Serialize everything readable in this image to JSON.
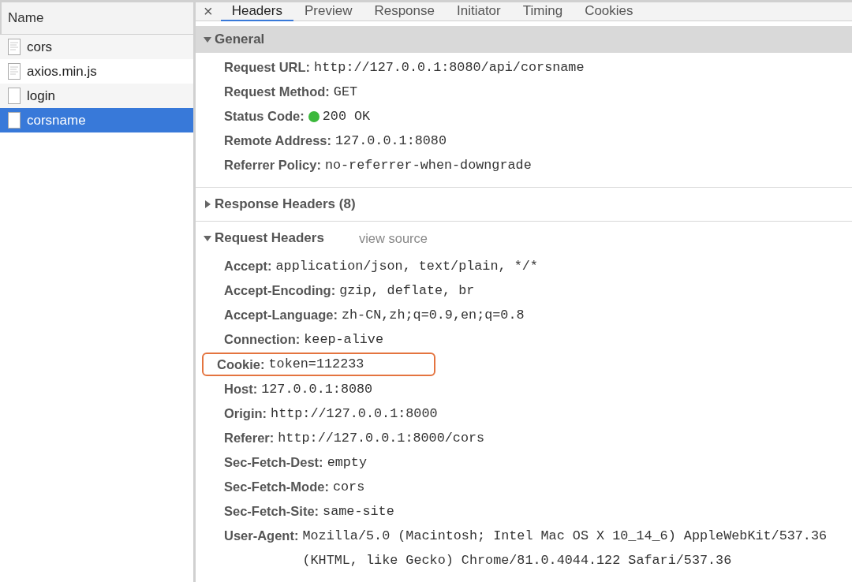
{
  "requests": {
    "column": "Name",
    "items": [
      {
        "name": "cors",
        "kind": "document",
        "selected": false
      },
      {
        "name": "axios.min.js",
        "kind": "document",
        "selected": false
      },
      {
        "name": "login",
        "kind": "blank",
        "selected": false
      },
      {
        "name": "corsname",
        "kind": "blank",
        "selected": true
      }
    ]
  },
  "close": "×",
  "tabs": [
    {
      "label": "Headers",
      "selected": true
    },
    {
      "label": "Preview",
      "selected": false
    },
    {
      "label": "Response",
      "selected": false
    },
    {
      "label": "Initiator",
      "selected": false
    },
    {
      "label": "Timing",
      "selected": false
    },
    {
      "label": "Cookies",
      "selected": false
    }
  ],
  "sections": [
    {
      "title": "General",
      "kind": "shaded",
      "expanded": true,
      "rows": [
        {
          "name": "Request URL:",
          "value": "http://127.0.0.1:8080/api/corsname",
          "highlighted": false
        },
        {
          "name": "Request Method:",
          "value": "GET",
          "highlighted": false
        },
        {
          "name": "Status Code:",
          "value": "200 OK",
          "color": "#3cb83c",
          "highlighted": false
        },
        {
          "name": "Remote Address:",
          "value": "127.0.0.1:8080",
          "highlighted": false
        },
        {
          "name": "Referrer Policy:",
          "value": "no-referrer-when-downgrade",
          "highlighted": false
        }
      ]
    },
    {
      "title": "Response Headers (8)",
      "kind": "plain",
      "expanded": false
    },
    {
      "title": "Request Headers",
      "kind": "plain",
      "expanded": true,
      "link": "view source",
      "rows": [
        {
          "name": "Accept:",
          "value": "application/json, text/plain, */*",
          "highlighted": false
        },
        {
          "name": "Accept-Encoding:",
          "value": "gzip, deflate, br",
          "highlighted": false
        },
        {
          "name": "Accept-Language:",
          "value": "zh-CN,zh;q=0.9,en;q=0.8",
          "highlighted": false
        },
        {
          "name": "Connection:",
          "value": "keep-alive",
          "highlighted": false
        },
        {
          "name": "Cookie:",
          "value": "token=112233",
          "highlighted": true
        },
        {
          "name": "Host:",
          "value": "127.0.0.1:8080",
          "highlighted": false
        },
        {
          "name": "Origin:",
          "value": "http://127.0.0.1:8000",
          "highlighted": false
        },
        {
          "name": "Referer:",
          "value": "http://127.0.0.1:8000/cors",
          "highlighted": false
        },
        {
          "name": "Sec-Fetch-Dest:",
          "value": "empty",
          "highlighted": false
        },
        {
          "name": "Sec-Fetch-Mode:",
          "value": "cors",
          "highlighted": false
        },
        {
          "name": "Sec-Fetch-Site:",
          "value": "same-site",
          "highlighted": false
        },
        {
          "name": "User-Agent:",
          "value": "Mozilla/5.0 (Macintosh; Intel Mac OS X 10_14_6) AppleWebKit/537.36 (KHTML, like Gecko) Chrome/81.0.4044.122 Safari/537.36",
          "highlighted": false
        }
      ]
    }
  ]
}
